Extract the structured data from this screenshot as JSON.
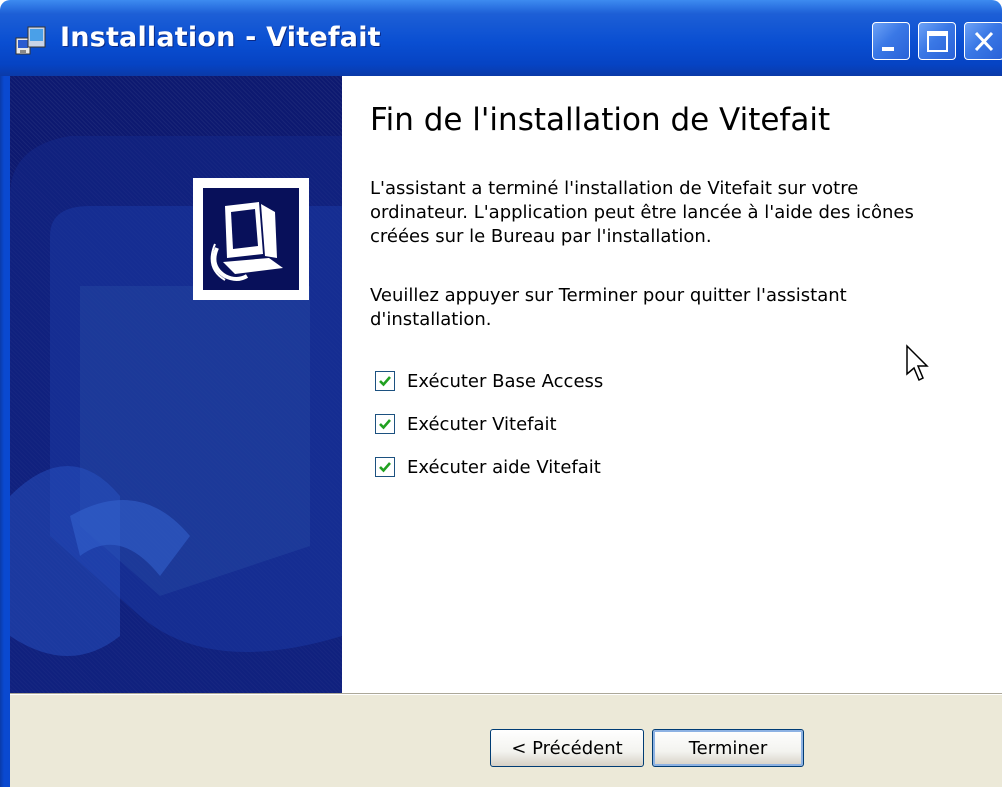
{
  "window": {
    "title": "Installation - Vitefait",
    "app_icon": "installer-icon",
    "controls": [
      "minimize-icon",
      "maximize-icon",
      "close-icon"
    ]
  },
  "sidebar": {
    "logo_icon": "computer-install-icon"
  },
  "main": {
    "heading": "Fin de l'installation de Vitefait",
    "paragraph1": "L'assistant a terminé l'installation de Vitefait sur votre ordinateur. L'application peut être lancée à l'aide des icônes créées sur le Bureau par l'installation.",
    "paragraph2": "Veuillez appuyer sur Terminer pour quitter l'assistant d'installation.",
    "options": [
      {
        "label": "Exécuter Base Access",
        "checked": true
      },
      {
        "label": "Exécuter Vitefait",
        "checked": true
      },
      {
        "label": "Exécuter aide Vitefait",
        "checked": true
      }
    ]
  },
  "buttons": {
    "back_label": "< Précédent",
    "finish_label": "Terminer"
  },
  "colors": {
    "titlebar": "#0a4fd2",
    "sidebar": "#0d1970",
    "button_face": "#ece9d8",
    "check": "#21a121"
  }
}
